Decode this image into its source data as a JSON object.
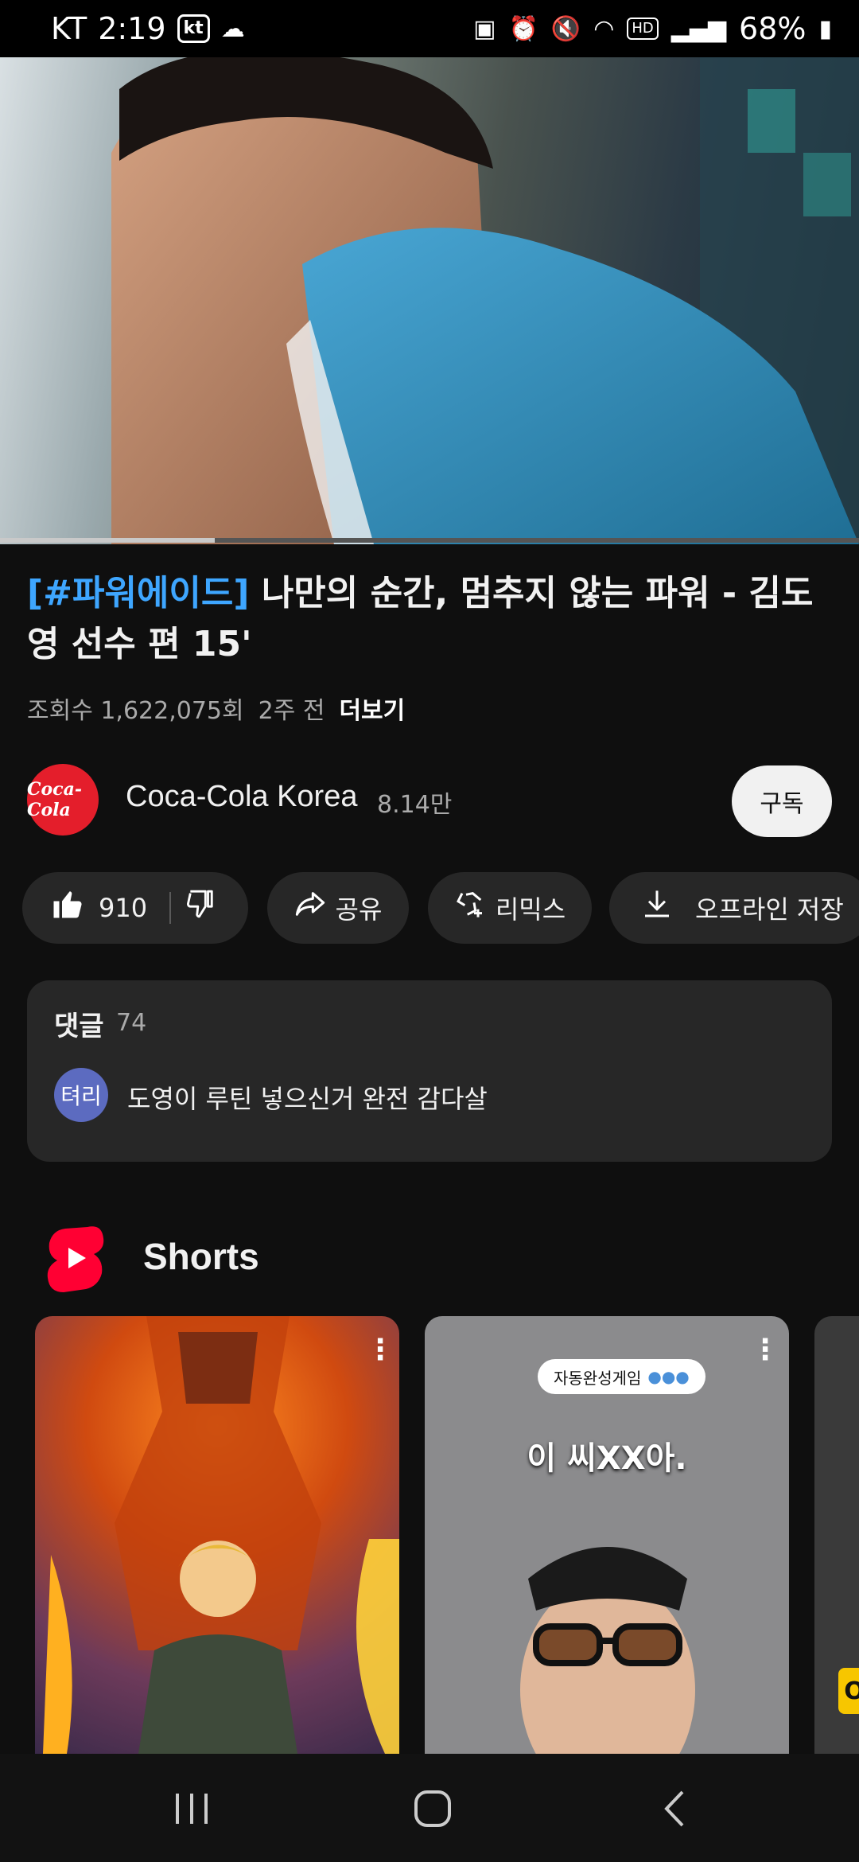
{
  "status_bar": {
    "carrier": "KT",
    "time": "2:19",
    "carrier_logo": "kt",
    "hd_badge": "HD",
    "battery": "68%"
  },
  "video": {
    "title_hashtag": "[#파워에이드]",
    "title_rest": " 나만의 순간, 멈추지 않는 파워 - 김도영 선수 편 15'",
    "views": "조회수 1,622,075회",
    "age": "2주 전",
    "more_label": "더보기",
    "progress_fraction": 0.25
  },
  "channel": {
    "name": "Coca-Cola Korea",
    "subscribers": "8.14만",
    "avatar_text": "Coca-Cola",
    "subscribe_label": "구독"
  },
  "actions": {
    "likes": "910",
    "share_label": "공유",
    "remix_label": "리믹스",
    "download_label": "오프라인 저장"
  },
  "comments": {
    "label": "댓글",
    "count": "74",
    "top_author_initials": "텨리",
    "top_comment": "도영이 루틴 넣으신거 완전 감다살"
  },
  "shorts": {
    "section_title": "Shorts",
    "cards": [
      {
        "menu_icon": "kebab-icon"
      },
      {
        "chip_text": "자동완성게임",
        "chip_dots": "●●●",
        "caption": "이 씨XX아.",
        "menu_icon": "kebab-icon"
      },
      {
        "badge_text": "O"
      }
    ]
  },
  "colors": {
    "background": "#0f0f0f",
    "pill": "#272727",
    "hashtag": "#3ea6ff",
    "shorts_red": "#ff0033"
  }
}
